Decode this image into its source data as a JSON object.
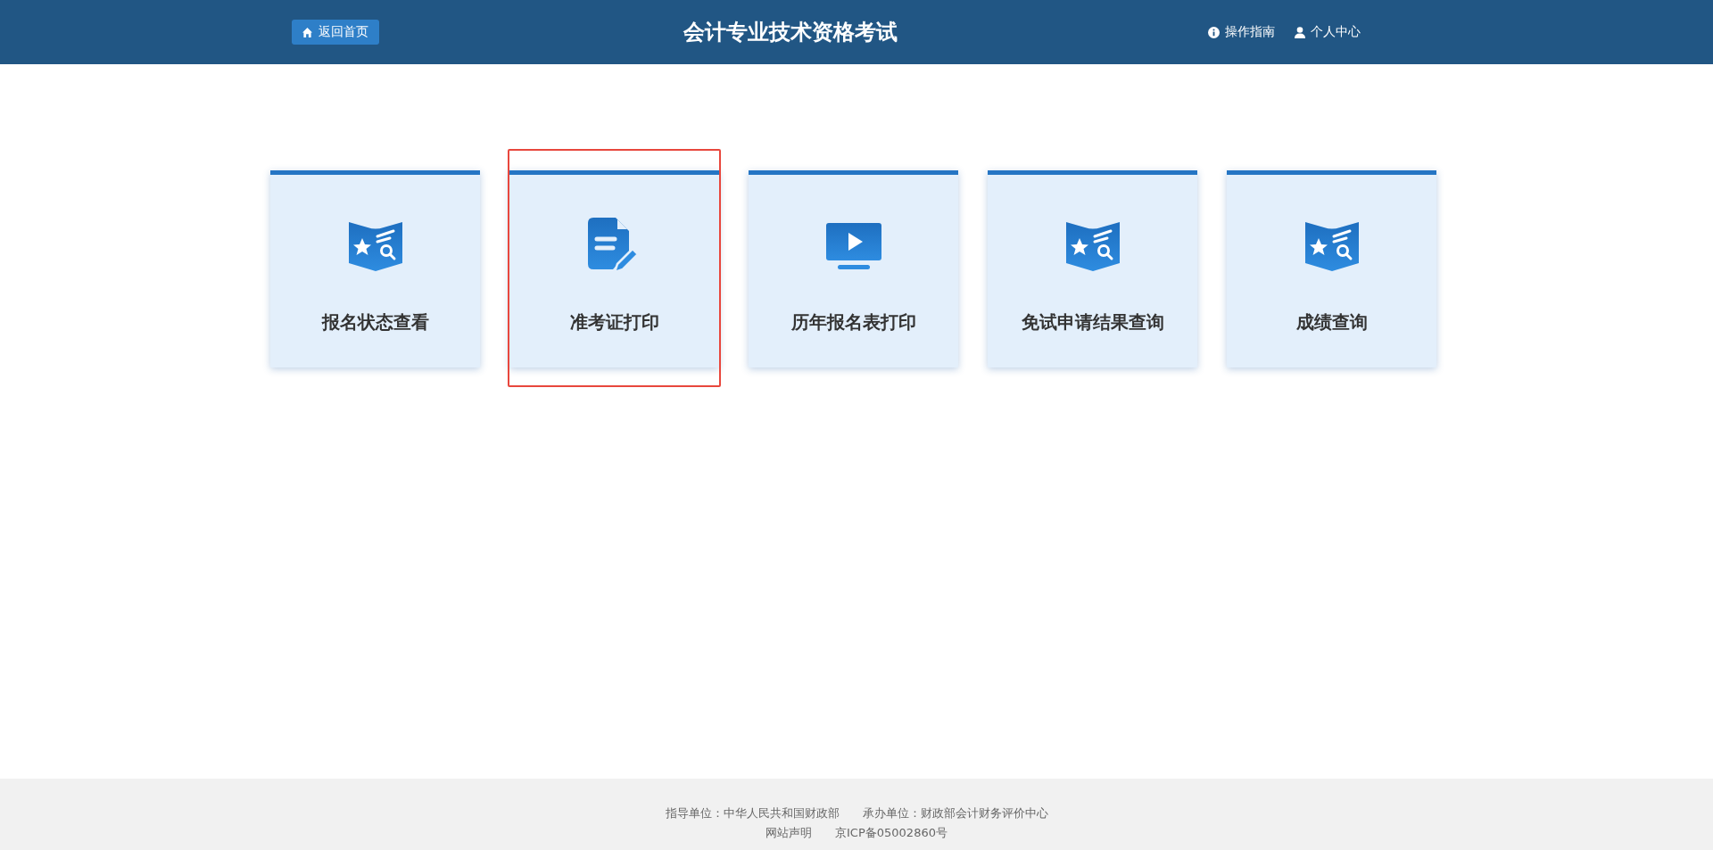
{
  "header": {
    "back_button": "返回首页",
    "title": "会计专业技术资格考试",
    "links": [
      {
        "label": "操作指南",
        "kind": "info"
      },
      {
        "label": "个人中心",
        "kind": "user"
      }
    ]
  },
  "cards": [
    {
      "label": "报名状态查看",
      "kind": "book-search",
      "highlighted": false
    },
    {
      "label": "准考证打印",
      "kind": "document-edit",
      "highlighted": true
    },
    {
      "label": "历年报名表打印",
      "kind": "monitor-play",
      "highlighted": false
    },
    {
      "label": "免试申请结果查询",
      "kind": "book-search",
      "highlighted": false
    },
    {
      "label": "成绩查询",
      "kind": "book-search",
      "highlighted": false
    }
  ],
  "footer": {
    "lines": [
      [
        "指导单位：中华人民共和国财政部",
        "承办单位：财政部会计财务评价中心"
      ],
      [
        "网站声明",
        "京ICP备05002860号"
      ]
    ]
  }
}
